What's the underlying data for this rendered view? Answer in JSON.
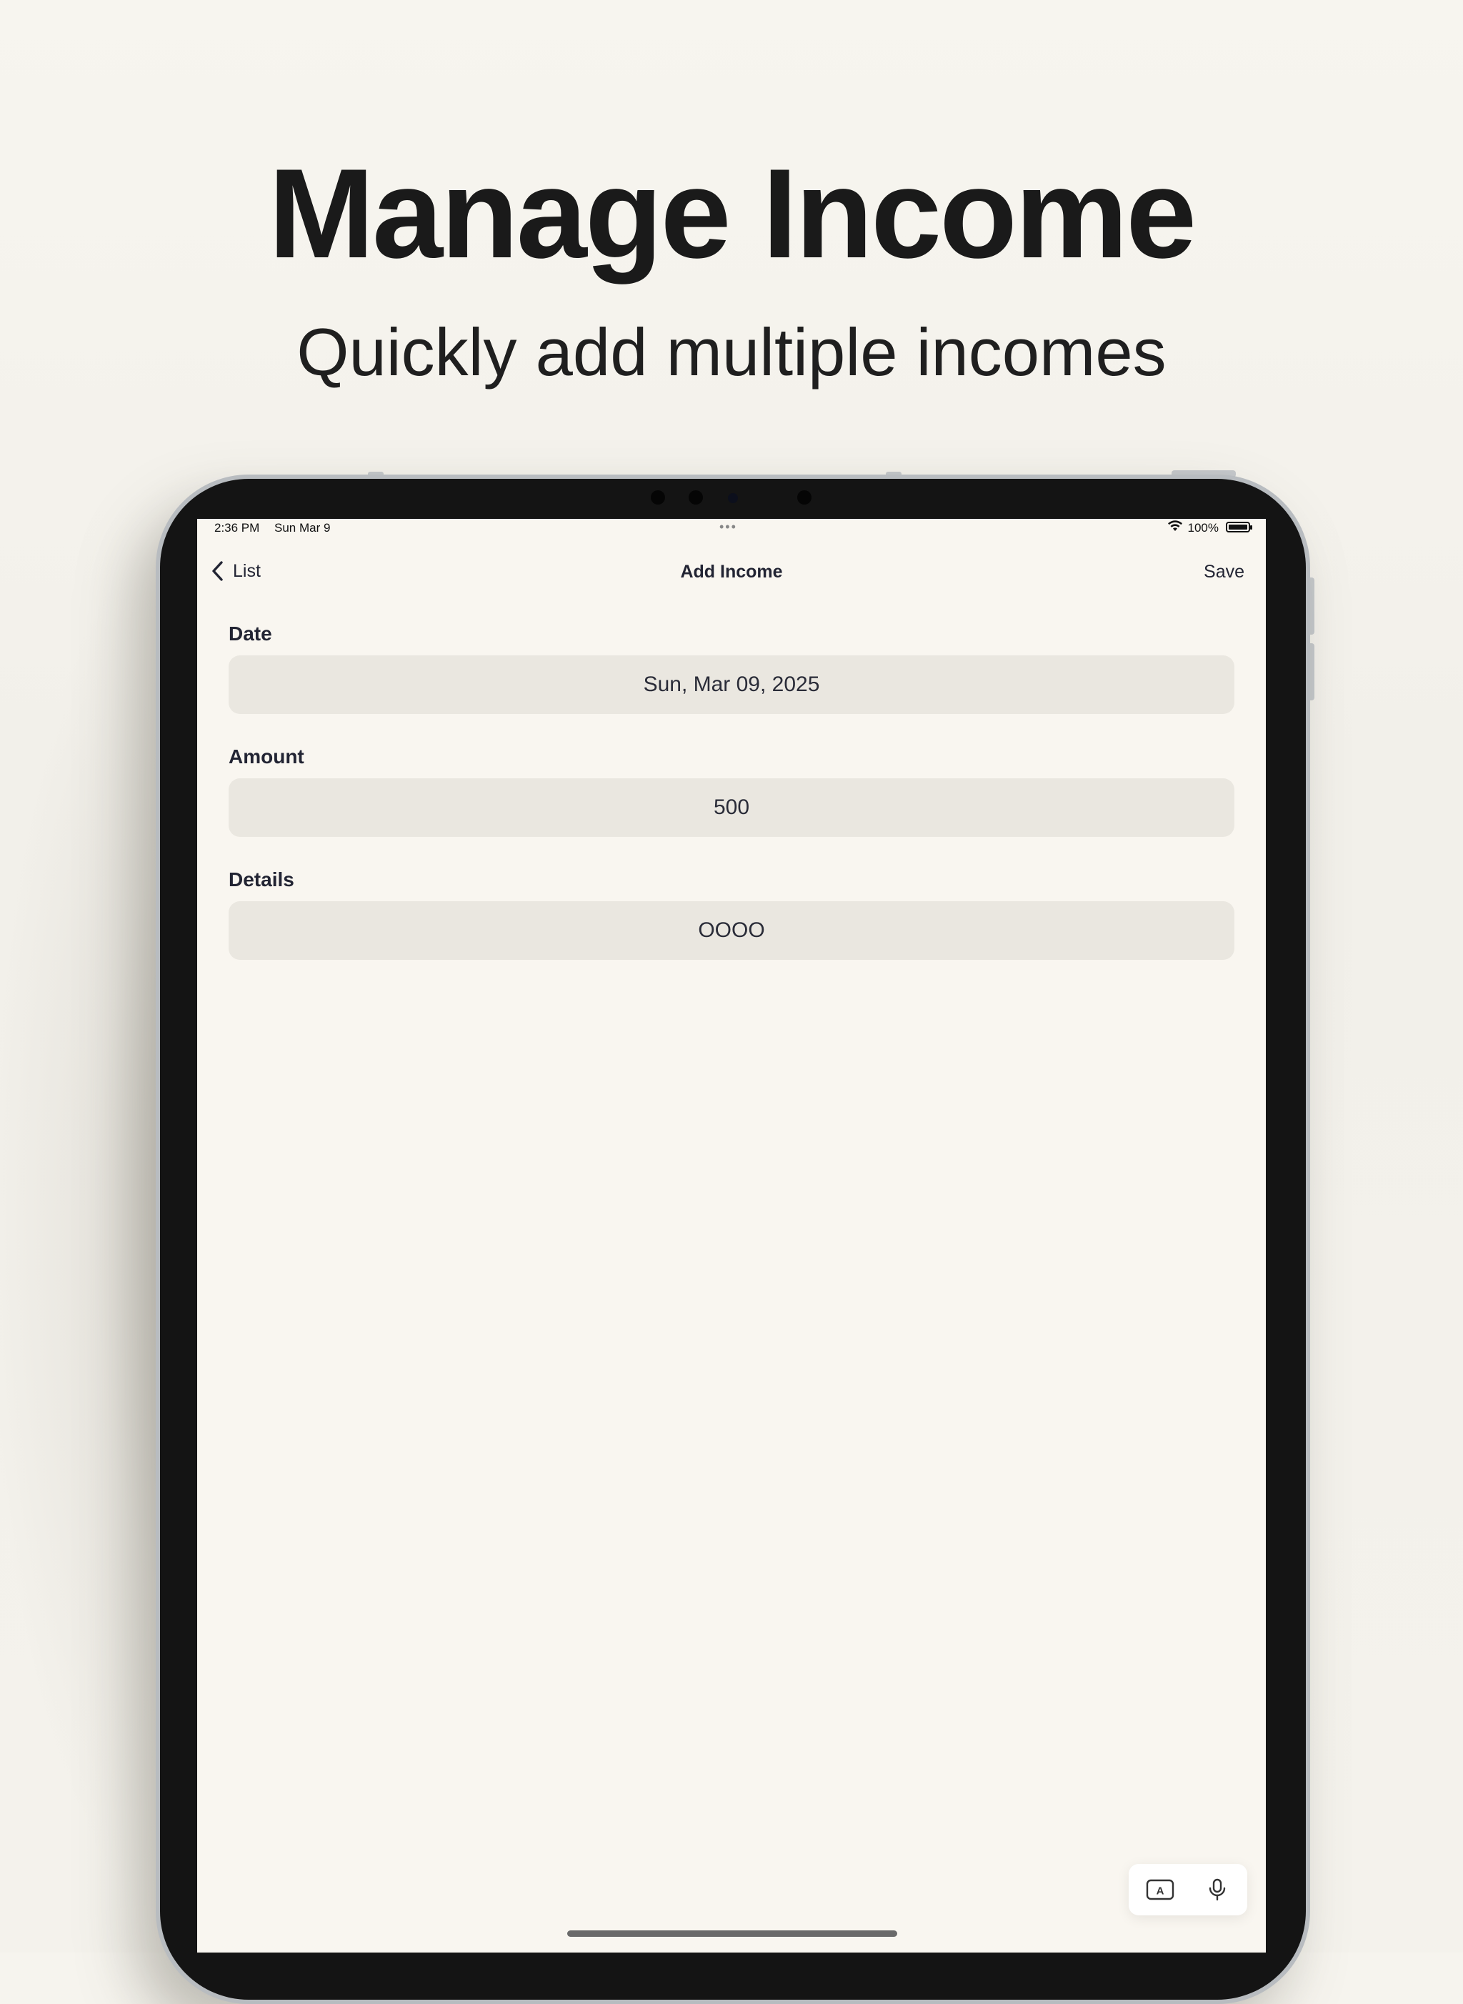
{
  "promo": {
    "headline": "Manage Income",
    "subheadline": "Quickly add multiple incomes"
  },
  "status_bar": {
    "time": "2:36 PM",
    "date": "Sun Mar 9",
    "battery_percent": "100%",
    "icons": [
      "wifi-icon",
      "battery-icon",
      "multitasking-dots-icon"
    ]
  },
  "navbar": {
    "back_label": "List",
    "title": "Add Income",
    "save_label": "Save"
  },
  "form": {
    "date_label": "Date",
    "date_value": "Sun, Mar 09, 2025",
    "amount_label": "Amount",
    "amount_value": "500",
    "details_label": "Details",
    "details_value": "OOOO"
  },
  "keyboard_toolbar": {
    "icons": [
      "text-format-icon",
      "microphone-icon"
    ],
    "format_key_glyph": "A"
  },
  "colors": {
    "background": "#f6f4ee",
    "screen_background": "#f9f6f0",
    "field_background": "#eae7e0",
    "text_dark": "#222433",
    "device_frame": "#141414"
  }
}
